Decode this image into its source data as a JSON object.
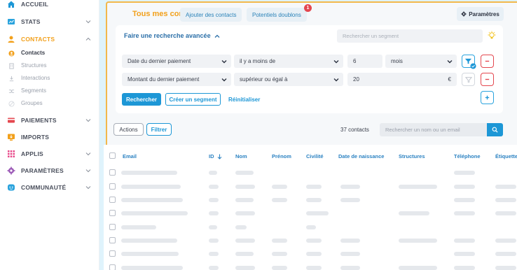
{
  "sidebar": {
    "items": [
      {
        "label": "ACCUEIL",
        "icon": "home-icon"
      },
      {
        "label": "STATS",
        "icon": "stats-icon"
      },
      {
        "label": "CONTACTS",
        "icon": "contacts-icon"
      },
      {
        "label": "PAIEMENTS",
        "icon": "payment-icon"
      },
      {
        "label": "IMPORTS",
        "icon": "import-icon"
      },
      {
        "label": "APPLIS",
        "icon": "apps-icon"
      },
      {
        "label": "PARAMÈTRES",
        "icon": "settings-icon"
      },
      {
        "label": "COMMUNAUTÉ",
        "icon": "community-icon"
      }
    ],
    "contacts_sub": [
      {
        "label": "Contacts",
        "icon": "user-icon"
      },
      {
        "label": "Structures",
        "icon": "building-icon"
      },
      {
        "label": "Interactions",
        "icon": "interaction-icon"
      },
      {
        "label": "Segments",
        "icon": "segments-icon"
      },
      {
        "label": "Groupes",
        "icon": "groups-icon"
      }
    ]
  },
  "header": {
    "title": "Tous mes contacts",
    "tabs": [
      {
        "label": "Ajouter des contacts"
      },
      {
        "label": "Potentiels doublons"
      }
    ],
    "doublons_badge": "1",
    "settings_label": "Paramètres"
  },
  "advanced_search": {
    "title": "Faire une recherche avancée",
    "segment_placeholder": "Rechercher un segment",
    "rows": [
      {
        "field": "Date du dernier paiement",
        "operator": "il y a moins de",
        "value": "6",
        "unit": "mois"
      },
      {
        "field": "Montant du dernier paiement",
        "operator": "supérieur ou égal à",
        "value": "20",
        "unit": "€"
      }
    ],
    "search_btn": "Rechercher",
    "create_segment_btn": "Créer un segment",
    "reset_btn": "Réinitialiser"
  },
  "table_toolbar": {
    "actions_label": "Actions",
    "filter_label": "Filtrer",
    "count": "37 contacts",
    "search_placeholder": "Rechercher un nom ou un email"
  },
  "table": {
    "columns": [
      "Email",
      "ID",
      "Nom",
      "Prénom",
      "Civilité",
      "Date de naissance",
      "Structures",
      "Téléphone",
      "Étiquettes"
    ]
  },
  "colors": {
    "accent": "#f2a01b",
    "primary": "#1d97d6",
    "danger": "#e4474f"
  }
}
